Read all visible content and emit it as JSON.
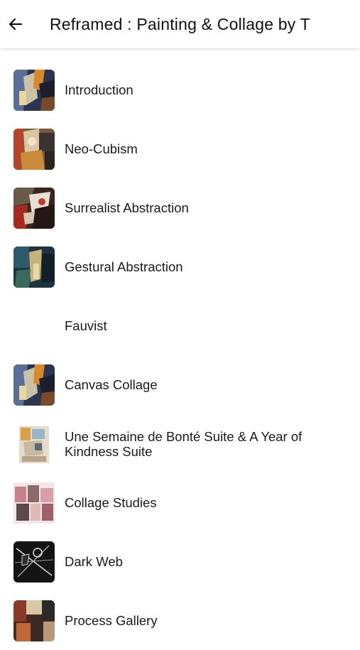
{
  "header": {
    "title": "Reframed : Painting & Collage by T",
    "back_icon": "arrow-left-icon"
  },
  "chapters": [
    {
      "label": "Introduction",
      "thumbnail": true
    },
    {
      "label": "Neo-Cubism",
      "thumbnail": true
    },
    {
      "label": "Surrealist Abstraction",
      "thumbnail": true
    },
    {
      "label": "Gestural Abstraction",
      "thumbnail": true
    },
    {
      "label": "Fauvist",
      "thumbnail": false
    },
    {
      "label": "Canvas Collage",
      "thumbnail": true
    },
    {
      "label": "Une Semaine de Bonté Suite & A Year of Kindness Suite",
      "thumbnail": true
    },
    {
      "label": "Collage Studies",
      "thumbnail": true
    },
    {
      "label": "Dark Web",
      "thumbnail": true
    },
    {
      "label": "Process Gallery",
      "thumbnail": true
    }
  ]
}
